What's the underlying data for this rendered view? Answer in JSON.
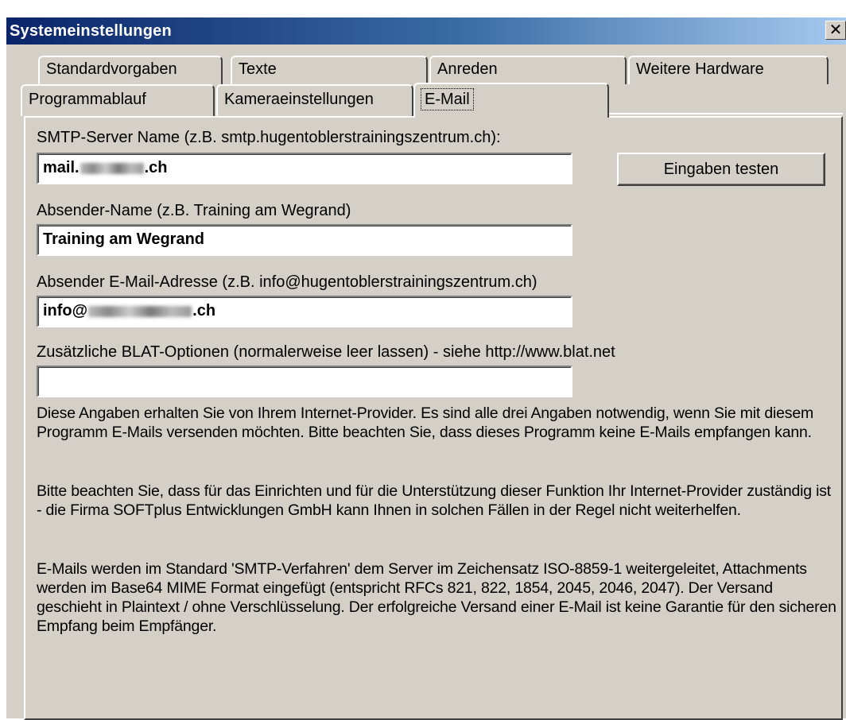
{
  "window": {
    "title": "Systemeinstellungen",
    "close_glyph": "✕"
  },
  "tabs_back_row": [
    "Standardvorgaben",
    "Texte",
    "Anreden",
    "Weitere Hardware"
  ],
  "tabs_front_row": [
    "Programmablauf",
    "Kameraeinstellungen",
    "E-Mail"
  ],
  "active_tab": "E-Mail",
  "fields": {
    "smtp_label": "SMTP-Server Name (z.B. smtp.hugentoblerstrainingszentrum.ch):",
    "smtp_prefix": "mail.",
    "smtp_suffix": ".ch",
    "sender_name_label": "Absender-Name (z.B. Training am Wegrand)",
    "sender_name_value": "Training am Wegrand",
    "sender_email_label": "Absender E-Mail-Adresse (z.B. info@hugentoblerstrainingszentrum.ch)",
    "sender_email_prefix": "info@",
    "sender_email_suffix": ".ch",
    "blat_label": "Zusätzliche BLAT-Optionen (normalerweise leer lassen) - siehe http://www.blat.net",
    "blat_value": ""
  },
  "test_button_label": "Eingaben testen",
  "paragraphs": [
    "Diese Angaben erhalten Sie von Ihrem Internet-Provider. Es sind alle drei Angaben notwendig, wenn Sie mit diesem Programm E-Mails versenden möchten. Bitte beachten Sie, dass dieses Programm keine E-Mails empfangen kann.",
    "Bitte beachten Sie, dass für das Einrichten und für die Unterstützung dieser Funktion Ihr Internet-Provider zuständig ist - die Firma SOFTplus Entwicklungen GmbH kann Ihnen in solchen Fällen in der Regel nicht weiterhelfen.",
    "E-Mails werden im Standard 'SMTP-Verfahren' dem Server im Zeichensatz ISO-8859-1 weitergeleitet, Attachments werden im Base64 MIME Format eingefügt (entspricht RFCs 821, 822, 1854, 2045, 2046, 2047). Der Versand geschieht in Plaintext / ohne Verschlüsselung. Der erfolgreiche Versand einer E-Mail ist keine Garantie für den sicheren Empfang beim Empfänger."
  ],
  "colors": {
    "dialog_bg": "#d4d0c8",
    "title_gradient_start": "#0a246a",
    "title_gradient_end": "#a6caf0"
  }
}
